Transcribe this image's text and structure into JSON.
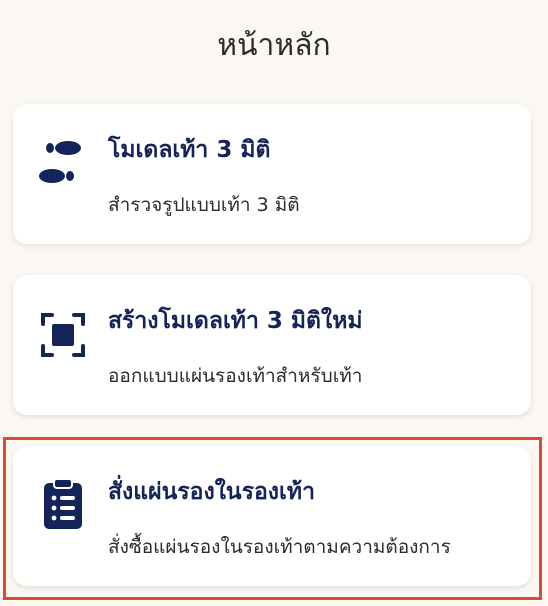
{
  "header": {
    "title": "หน้าหลัก"
  },
  "cards": [
    {
      "title": "โมเดลเท้า 3 มิติ",
      "subtitle": "สำรวจรูปแบบเท้า 3 มิติ",
      "icon": "footprints-icon"
    },
    {
      "title": "สร้างโมเดลเท้า 3 มิติใหม่",
      "subtitle": "ออกแบบแผ่นรองเท้าสำหรับเท้า",
      "icon": "scan-frame-icon"
    },
    {
      "title": "สั่งแผ่นรองในรองเท้า",
      "subtitle": "สั่งซื้อแผ่นรองในรองเท้าตามความต้องการ",
      "icon": "clipboard-list-icon"
    }
  ],
  "colors": {
    "background": "#fbf8f3",
    "card": "#ffffff",
    "accent": "#14245a",
    "highlight": "#e0492f"
  }
}
